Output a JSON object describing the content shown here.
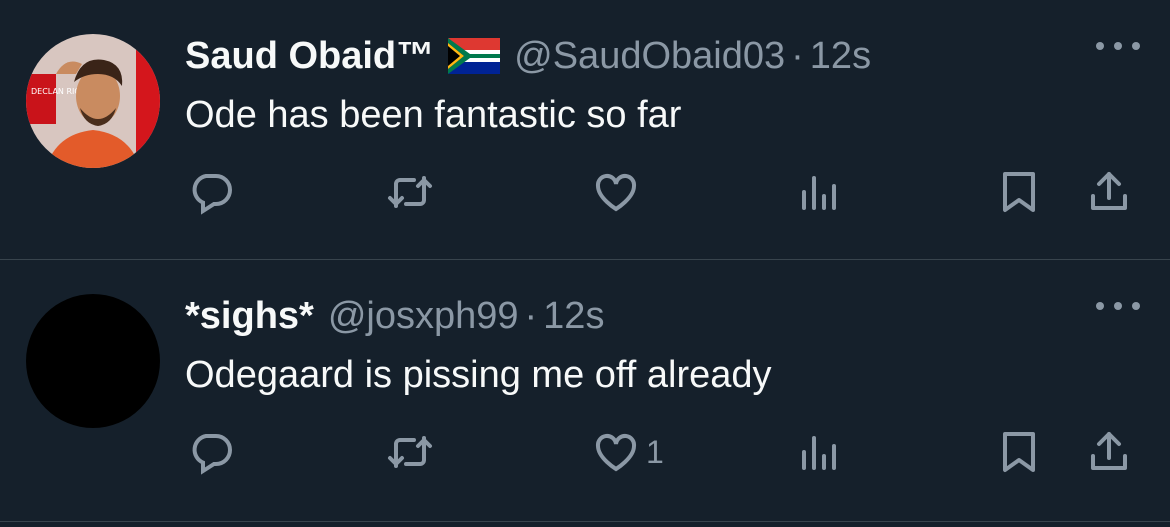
{
  "tweets": [
    {
      "display_name": "Saud Obaid™",
      "handle": "@SaudObaid03",
      "separator": "·",
      "time": "12s",
      "text": "Ode has been fantastic so far",
      "avatar_text": "DECLAN RICE",
      "like_count": ""
    },
    {
      "display_name": "*sighs*",
      "handle": "@josxph99",
      "separator": "·",
      "time": "12s",
      "text": "Odegaard is pissing me off already",
      "like_count": "1"
    }
  ],
  "colors": {
    "background": "#15202b",
    "text_primary": "#f7f9f9",
    "text_secondary": "#8b98a5",
    "divider": "#38444d"
  },
  "icons": [
    "reply-icon",
    "retweet-icon",
    "like-icon",
    "views-icon",
    "bookmark-icon",
    "share-icon",
    "more-icon",
    "south-africa-flag-icon"
  ]
}
